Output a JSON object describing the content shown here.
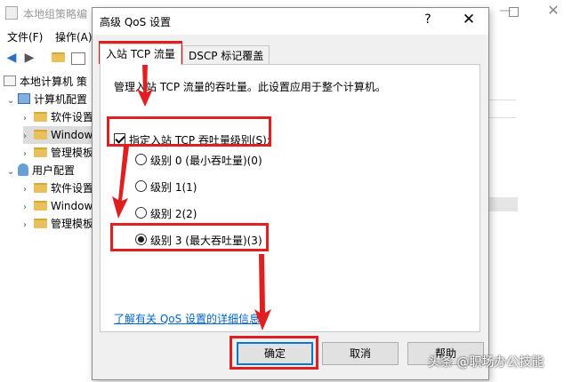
{
  "background_window": {
    "title": "本地组策略编",
    "menu": [
      "文件(F)",
      "操作(A)"
    ],
    "tree": [
      {
        "label": "本地计算机 策",
        "indent": 0,
        "icon": "policy-icon"
      },
      {
        "label": "计算机配置",
        "indent": 1,
        "icon": "computer-icon",
        "expanded": true
      },
      {
        "label": "软件设置",
        "indent": 2,
        "icon": "folder-icon"
      },
      {
        "label": "Window",
        "indent": 2,
        "icon": "folder-icon",
        "selected": true
      },
      {
        "label": "管理模板",
        "indent": 2,
        "icon": "folder-icon"
      },
      {
        "label": "用户配置",
        "indent": 1,
        "icon": "user-icon",
        "expanded": true
      },
      {
        "label": "软件设置",
        "indent": 2,
        "icon": "folder-icon"
      },
      {
        "label": "Window",
        "indent": 2,
        "icon": "folder-icon"
      },
      {
        "label": "管理模板",
        "indent": 2,
        "icon": "folder-icon"
      }
    ]
  },
  "dialog": {
    "title": "高级 QoS 设置",
    "help_glyph": "?",
    "close_glyph": "✕",
    "tabs": [
      {
        "label": "入站 TCP 流量",
        "active": true
      },
      {
        "label": "DSCP 标记覆盖",
        "active": false
      }
    ],
    "description": "管理入站 TCP 流量的吞吐量。此设置应用于整个计算机。",
    "limit_checkbox": {
      "label": "指定入站 TCP 吞吐量级别(S):",
      "checked": true
    },
    "levels": [
      {
        "label": "级别 0 (最小吞吐量)(0)",
        "selected": false
      },
      {
        "label": "级别 1(1)",
        "selected": false
      },
      {
        "label": "级别 2(2)",
        "selected": false
      },
      {
        "label": "级别 3 (最大吞吐量)(3)",
        "selected": true
      }
    ],
    "learn_link": "了解有关 QoS 设置的详细信息",
    "buttons": {
      "ok": "确定",
      "cancel": "取消",
      "help": "帮助"
    }
  },
  "watermark": "头条 @职场办公技能",
  "colors": {
    "annotation": "#e02020",
    "link": "#0066cc",
    "dialog_bg": "#f0f0f0"
  }
}
